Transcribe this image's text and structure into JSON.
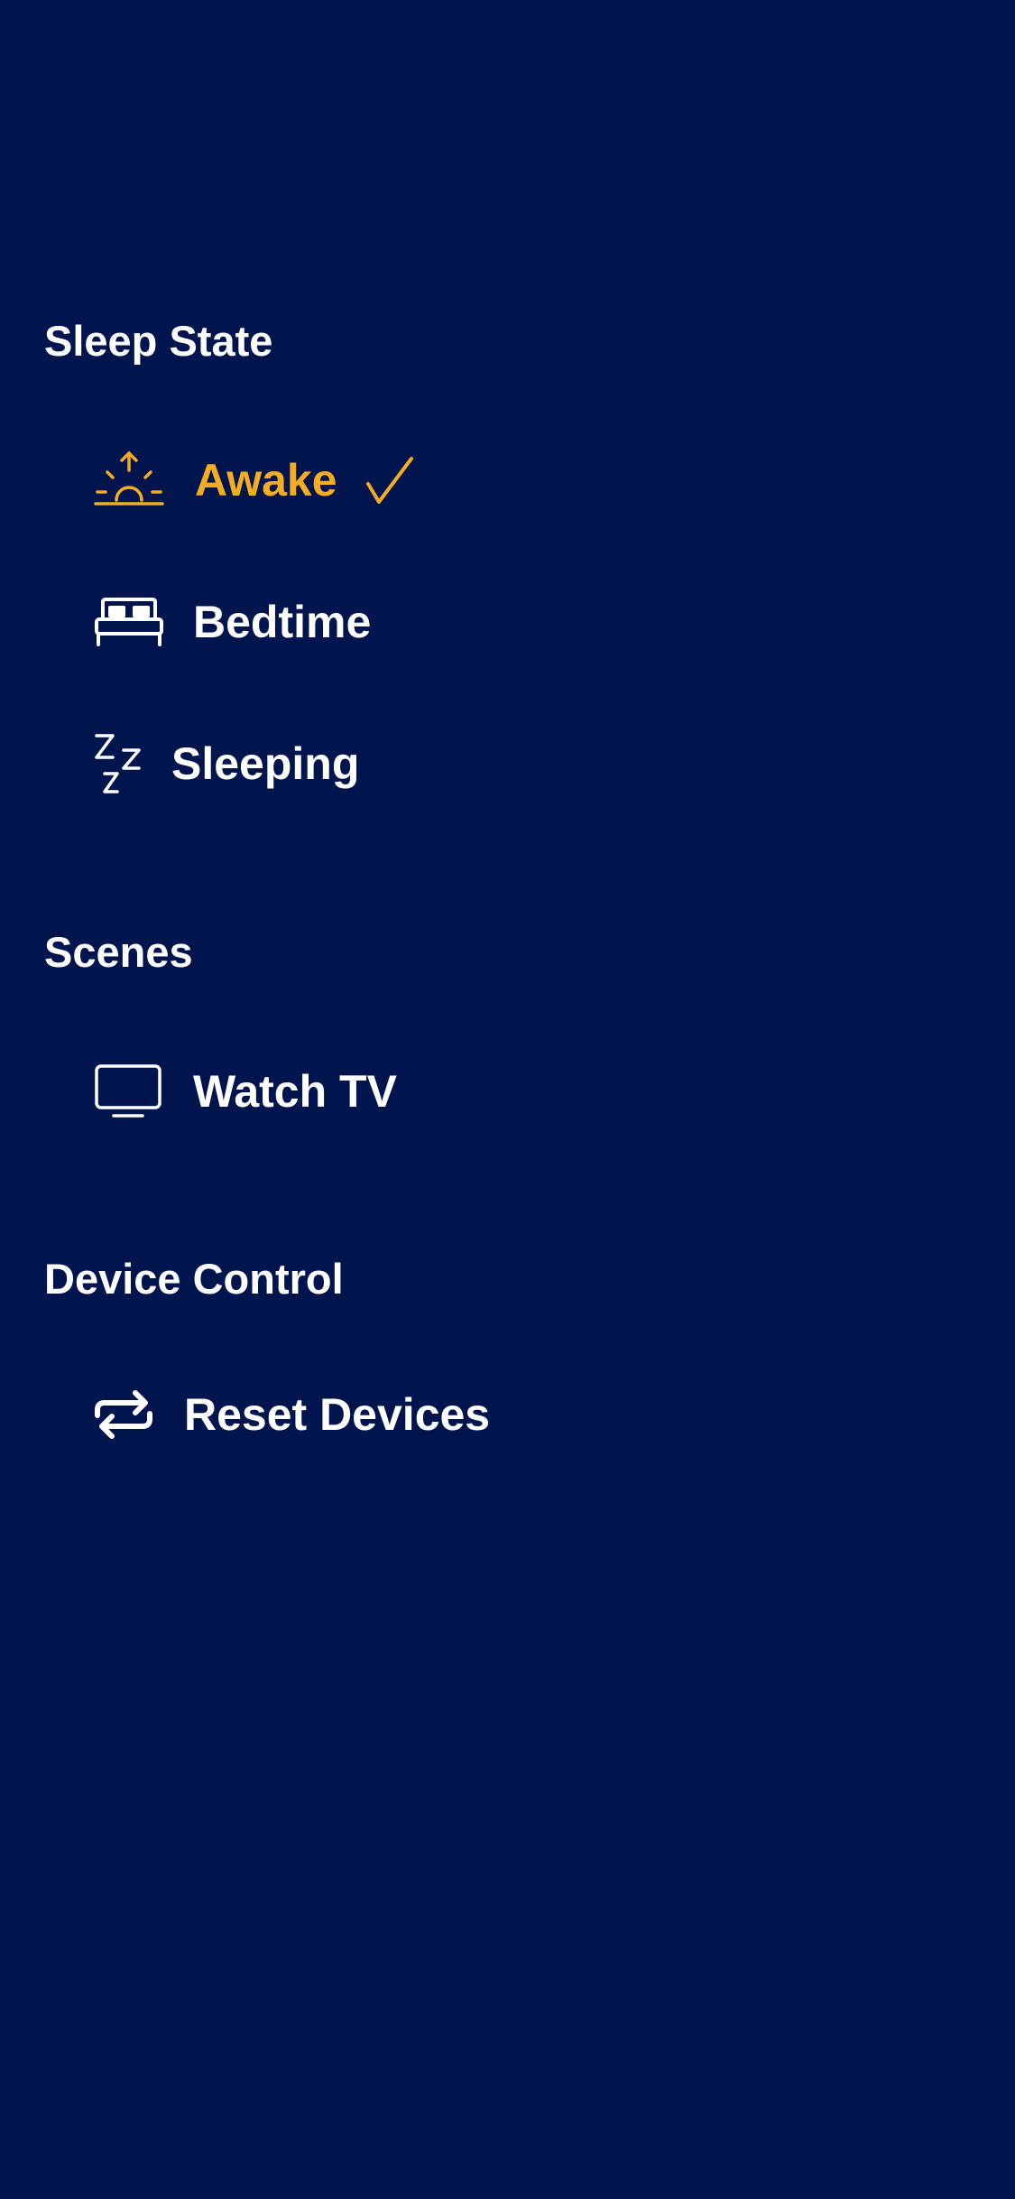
{
  "colors": {
    "background": "#00144d",
    "text": "#ffffff",
    "accent": "#f4ad22"
  },
  "sections": [
    {
      "title": "Sleep State",
      "items": [
        {
          "label": "Awake",
          "icon": "sunrise-icon",
          "selected": true
        },
        {
          "label": "Bedtime",
          "icon": "bed-icon",
          "selected": false
        },
        {
          "label": "Sleeping",
          "icon": "zzz-icon",
          "selected": false
        }
      ]
    },
    {
      "title": "Scenes",
      "items": [
        {
          "label": "Watch TV",
          "icon": "tv-icon",
          "selected": false
        }
      ]
    },
    {
      "title": "Device Control",
      "items": [
        {
          "label": "Reset Devices",
          "icon": "repeat-icon",
          "selected": false
        }
      ]
    }
  ]
}
